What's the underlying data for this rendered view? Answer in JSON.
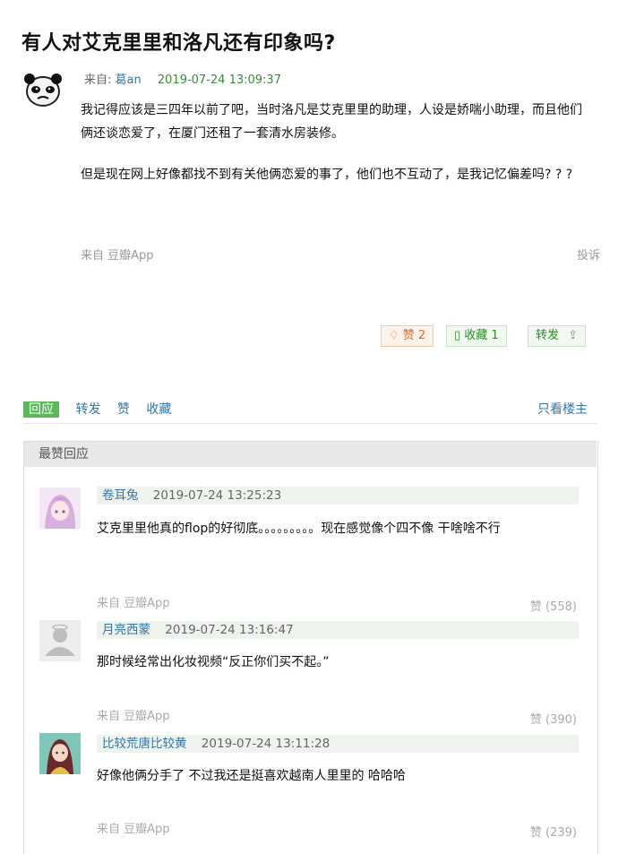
{
  "post": {
    "title": "有人对艾克里里和洛凡还有印象吗?",
    "from_label": "来自:",
    "author": "葛an",
    "time": "2019-07-24 13:09:37",
    "paragraphs": [
      "我记得应该是三四年以前了吧，当时洛凡是艾克里里的助理，人设是娇喘小助理，而且他们俩还谈恋爱了，在厦门还租了一套清水房装修。",
      "但是现在网上好像都找不到有关他俩恋爱的事了，他们也不互动了，是我记忆偏差吗? ? ?"
    ],
    "source": "来自 豆瓣App",
    "report": "投诉",
    "actions": {
      "like": "赞 2",
      "collect": "收藏 1",
      "share": "转发"
    }
  },
  "tabs": {
    "items": [
      "回应",
      "转发",
      "赞",
      "收藏"
    ],
    "only_op": "只看楼主"
  },
  "best_replies": {
    "header": "最赞回应",
    "items": [
      {
        "name": "卷耳兔",
        "time": "2019-07-24 13:25:23",
        "text": "艾克里里他真的flop的好彻底。。。。。。。。。现在感觉像个四不像 干啥啥不行",
        "source": "来自 豆瓣App",
        "likes": "赞 (558)"
      },
      {
        "name": "月亮西蒙",
        "time": "2019-07-24 13:16:47",
        "text": "那时候经常出化妆视频“反正你们买不起。”",
        "source": "来自 豆瓣App",
        "likes": "赞 (390)"
      },
      {
        "name": "比较荒唐比较黄",
        "time": "2019-07-24 13:11:28",
        "text": "好像他俩分手了 不过我还是挺喜欢越南人里里的 哈哈哈",
        "source": "来自 豆瓣App",
        "likes": "赞 (239)"
      }
    ]
  },
  "colors": {
    "link": "#3377aa",
    "green": "#5ab85a",
    "orange": "#e06a2a"
  }
}
